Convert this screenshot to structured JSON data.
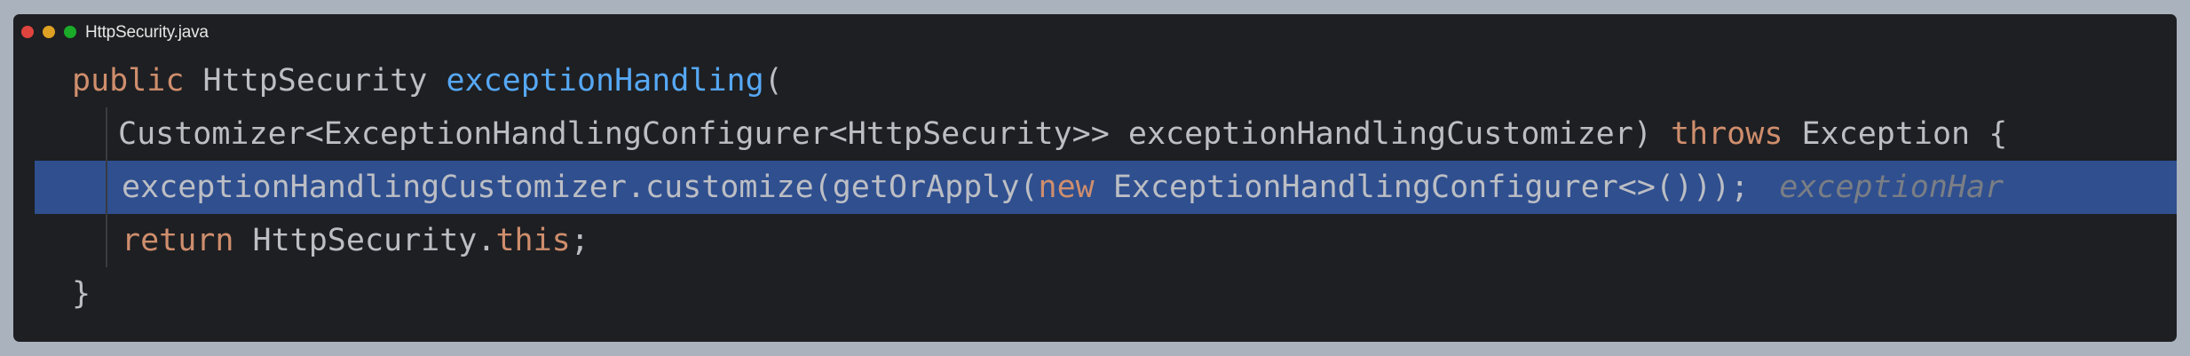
{
  "window": {
    "title": "HttpSecurity.java"
  },
  "code": {
    "line1": {
      "kw": "public",
      "type": " HttpSecurity ",
      "method": "exceptionHandling",
      "rest": "("
    },
    "line2": {
      "pre": "Customizer<ExceptionHandlingConfigurer<HttpSecurity>> exceptionHandlingCustomizer) ",
      "kw": "throws",
      "post": " Exception {"
    },
    "line3": {
      "pre": "exceptionHandlingCustomizer.customize(getOrApply(",
      "kw": "new",
      "post": " ExceptionHandlingConfigurer<>()));",
      "hint": "exceptionHar"
    },
    "line4": {
      "kw": "return",
      "mid": " HttpSecurity.",
      "kw2": "this",
      "post": ";"
    },
    "line5": {
      "text": "}"
    }
  },
  "colors": {
    "window_bg": "#1e1f22",
    "outer_bg": "#a9b2bd",
    "selection_bg": "#2f4f8f",
    "keyword": "#cf8e6d",
    "method": "#56a8f5",
    "text": "#bcbec4",
    "hint": "#7a7e85"
  },
  "icons": [
    "close-dot",
    "minimize-dot",
    "zoom-dot"
  ]
}
